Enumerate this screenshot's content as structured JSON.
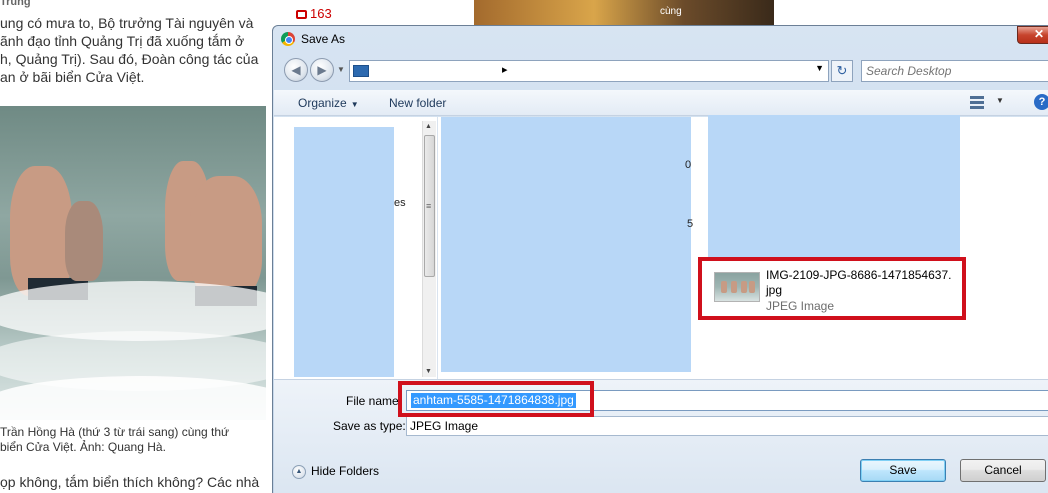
{
  "background": {
    "top_fragment": "Trung",
    "article_lines": [
      "ung có mưa to, Bộ trưởng Tài nguyên và",
      "ãnh đạo tỉnh Quảng Trị đã xuống tắm ở",
      "h, Quảng Trị). Sau đó, Đoàn công tác của",
      "an ở bãi biển Cửa Việt."
    ],
    "caption_lines": [
      "Trần Hồng Hà (thứ 3 từ trái sang) cùng thứ",
      "biển Cửa Việt. Ảnh: Quang Hà."
    ],
    "article_line_2": "ọp không, tắm biển thích không? Các nhà",
    "comment_count": "163",
    "side_text": [
      "cùng"
    ]
  },
  "dialog": {
    "title": "Save As",
    "close_label": "✕",
    "search_placeholder": "Search Desktop",
    "address_separator": "▸",
    "toolbar": {
      "organize_label": "Organize",
      "new_folder_label": "New folder"
    },
    "nav_fragment": "es",
    "list_fragments": [
      "0",
      "5"
    ],
    "file": {
      "name": "IMG-2109-JPG-8686-1471854637.jpg",
      "type": "JPEG Image"
    },
    "file_name_label": "File name:",
    "file_name_value": "anhtam-5585-1471864838.jpg",
    "save_as_type_label": "Save as type:",
    "save_as_type_value": "JPEG Image",
    "hide_folders_label": "Hide Folders",
    "save_button": "Save",
    "cancel_button": "Cancel"
  },
  "colors": {
    "highlight_box": "#d0101c",
    "selection": "#3399ff",
    "redacted": "#b8d7f7"
  }
}
